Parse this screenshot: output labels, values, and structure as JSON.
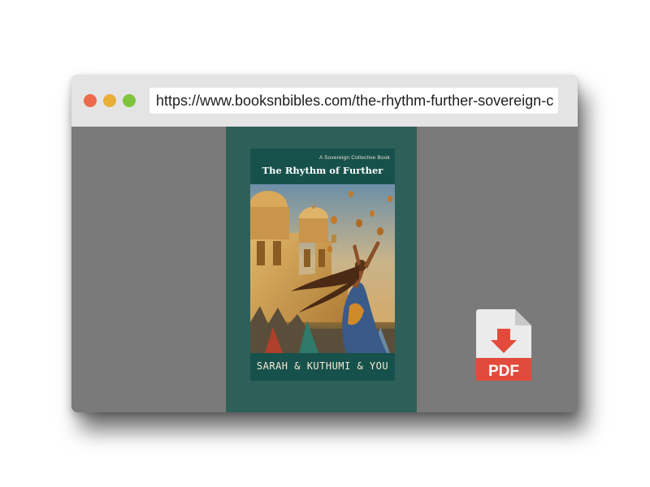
{
  "browser": {
    "url": "https://www.booksnbibles.com/the-rhythm-further-sovereign-c"
  },
  "book": {
    "series_label": "A Sovereign Collective Book",
    "title": "The Rhythm of Further",
    "authors": "SARAH & KUTHUMI & YOU"
  },
  "download": {
    "label": "PDF",
    "icon": "pdf-download-icon"
  },
  "colors": {
    "panel": "#2f5f59",
    "pdf_red": "#e24b3b"
  }
}
